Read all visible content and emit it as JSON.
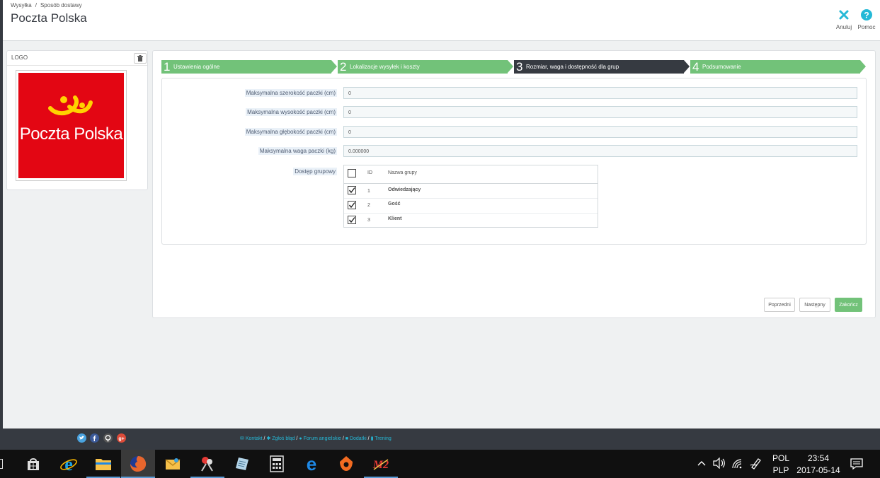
{
  "header": {
    "breadcrumb": [
      "Wysyłka",
      "Sposób dostawy"
    ],
    "breadcrumb_sep": "/",
    "title": "Poczta Polska",
    "toolbar": {
      "cancel_label": "Anuluj",
      "help_label": "Pomoc"
    }
  },
  "logo_panel": {
    "title": "LOGO",
    "image_text": "Poczta Polska",
    "image_color": "#e30613",
    "icon": "trash-icon"
  },
  "wizard": {
    "steps": [
      {
        "number": "1",
        "label": "Ustawienia ogólne"
      },
      {
        "number": "2",
        "label": "Lokalizacje wysyłek i koszty"
      },
      {
        "number": "3",
        "label": "Rozmiar, waga i dostępność dla grup"
      },
      {
        "number": "4",
        "label": "Podsumowanie"
      }
    ],
    "active_step": 3,
    "step_color": "#72c279",
    "active_color": "#363a41"
  },
  "form": {
    "fields": [
      {
        "label": "Maksymalna szerokość paczki (cm)",
        "value": "0"
      },
      {
        "label": "Maksymalna wysokość paczki (cm)",
        "value": "0"
      },
      {
        "label": "Maksymalna głębokość paczki (cm)",
        "value": "0"
      },
      {
        "label": "Maksymalna waga paczki (kg)",
        "value": "0.000000"
      }
    ],
    "group_access": {
      "label": "Dostęp grupowy",
      "headers": {
        "id": "ID",
        "name": "Nazwa grupy"
      },
      "rows": [
        {
          "id": "1",
          "name": "Odwiedzający",
          "checked": true
        },
        {
          "id": "2",
          "name": "Gość",
          "checked": true
        },
        {
          "id": "3",
          "name": "Klient",
          "checked": true
        }
      ]
    }
  },
  "buttons": {
    "previous": "Poprzedni",
    "next": "Następny",
    "finish": "Zakończ"
  },
  "footer": {
    "links": [
      "Kontakt",
      "Zgłoś błąd",
      "Forum angielskie",
      "Dodatki",
      "Trening"
    ],
    "link_sep": "/",
    "social": [
      "twitter-icon",
      "facebook-icon",
      "github-icon",
      "google-plus-icon"
    ]
  },
  "taskbar": {
    "lang_top": "POL",
    "lang_bottom": "PLP",
    "time": "23:54",
    "date": "2017-05-14"
  }
}
